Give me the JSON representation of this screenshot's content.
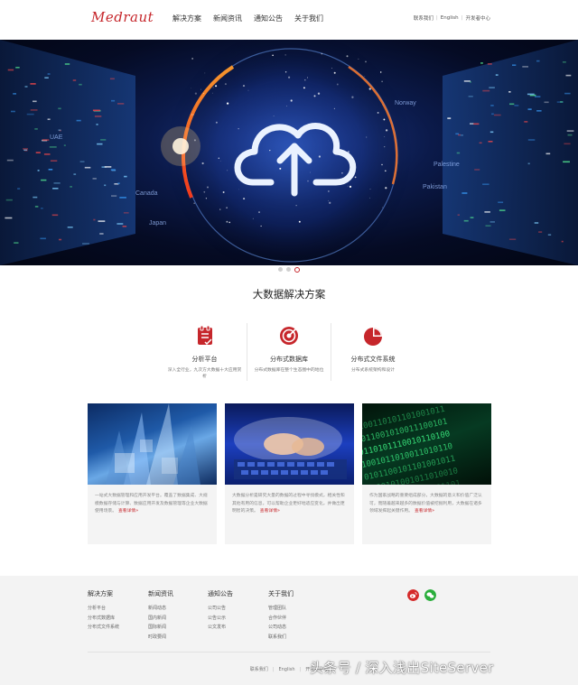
{
  "header": {
    "logo": "Medraut",
    "nav": [
      "解决方案",
      "新闻资讯",
      "通知公告",
      "关于我们"
    ],
    "toplinks": [
      "联系我们",
      "English",
      "开发者中心"
    ]
  },
  "banner": {
    "map_labels": [
      "UAE",
      "Canada",
      "Palestine",
      "Pakistan",
      "Norway",
      "Japan"
    ],
    "icon": "cloud-upload-icon",
    "slides": 3,
    "active_slide": 3
  },
  "section": {
    "title": "大数据解决方案"
  },
  "features": [
    {
      "icon": "document-check-icon",
      "title": "分析平台",
      "desc": "深入全行业，九次方大数据十大应用赏析"
    },
    {
      "icon": "target-icon",
      "title": "分布式数据库",
      "desc": "分布式数据库在整个生态圈中的地位"
    },
    {
      "icon": "pie-chart-icon",
      "title": "分布式文件系统",
      "desc": "分布式系统架构和设计"
    }
  ],
  "cards": [
    {
      "image": "city-buildings-image",
      "text": "一站式大数据管理和应用开发平台。覆盖了数据集成、大规模数据存储与计算、数据应用开发及数据管理等企业大数据使用场景。",
      "more": "查看详情»"
    },
    {
      "image": "keyboard-typing-image",
      "text": "大数据分析是研究大量的数据的过程中寻找模式，相关性和其他有用的信息，可以帮助企业更好地适应变化，并做出更明智的决策。",
      "more": "查看详情»"
    },
    {
      "image": "binary-code-image",
      "text": "作为国家战略的重要组成部分，大数据的意义和价值广泛认可，而随着越来越多的数据价值被挖掘利用，大数据在诸多领域发挥起关键作用。",
      "more": "查看详情»"
    }
  ],
  "footer": {
    "columns": [
      {
        "title": "解决方案",
        "items": [
          "分析平台",
          "分布式数据库",
          "分布式文件系统"
        ]
      },
      {
        "title": "新闻资讯",
        "items": [
          "新闻动态",
          "国内新闻",
          "国际新闻",
          "时政要闻"
        ]
      },
      {
        "title": "通知公告",
        "items": [
          "公司公告",
          "公告公示",
          "公文发布"
        ]
      },
      {
        "title": "关于我们",
        "items": [
          "管理团队",
          "合作伙伴",
          "公司动态",
          "联系我们"
        ]
      }
    ],
    "social": [
      {
        "icon": "weibo-icon",
        "color": "#d52a2a"
      },
      {
        "icon": "wechat-icon",
        "color": "#2aae3c"
      }
    ],
    "bottom_links": [
      "联系我们",
      "English",
      "开发者中心"
    ],
    "watermark": "头条号 / 深入浅出SiteServer"
  },
  "colors": {
    "accent": "#c6262b",
    "footer_bg": "#f3f3f3",
    "card_bg": "#f4f4f4"
  }
}
